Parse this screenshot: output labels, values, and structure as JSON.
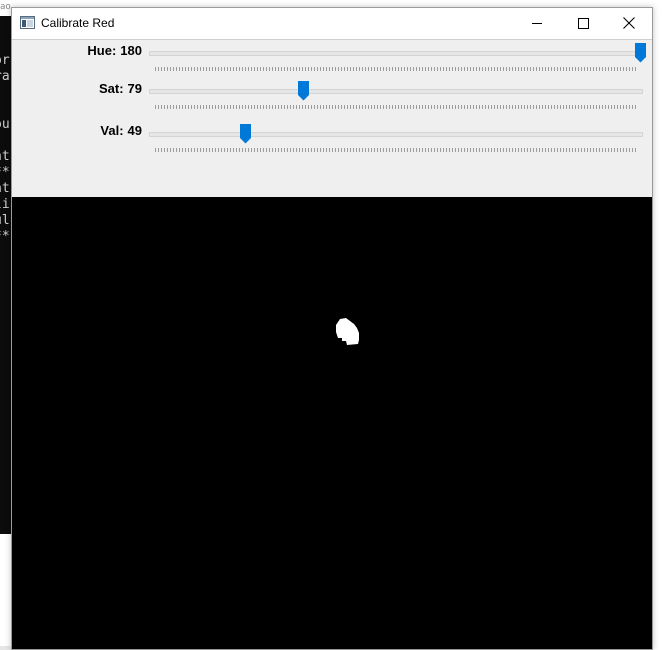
{
  "window": {
    "title": "Calibrate Red"
  },
  "background_console": {
    "title_fragment": "ao",
    "lines": [
      "or",
      "ra",
      "",
      "",
      "ou",
      "",
      "nt",
      "**",
      "at",
      "li",
      "ul",
      "**"
    ]
  },
  "trackbars": [
    {
      "label": "Hue:",
      "value": "180",
      "max": 180,
      "fraction": 1.0
    },
    {
      "label": "Sat:",
      "value": "79",
      "max": 255,
      "fraction": 0.31
    },
    {
      "label": "Val:",
      "value": "49",
      "max": 255,
      "fraction": 0.19
    }
  ],
  "colors": {
    "accent": "#0078d7",
    "image_bg": "#000000",
    "mask": "#ffffff"
  },
  "icons": {
    "app": "window-app-icon",
    "minimize": "minimize-icon",
    "maximize": "maximize-icon",
    "close": "close-icon"
  }
}
